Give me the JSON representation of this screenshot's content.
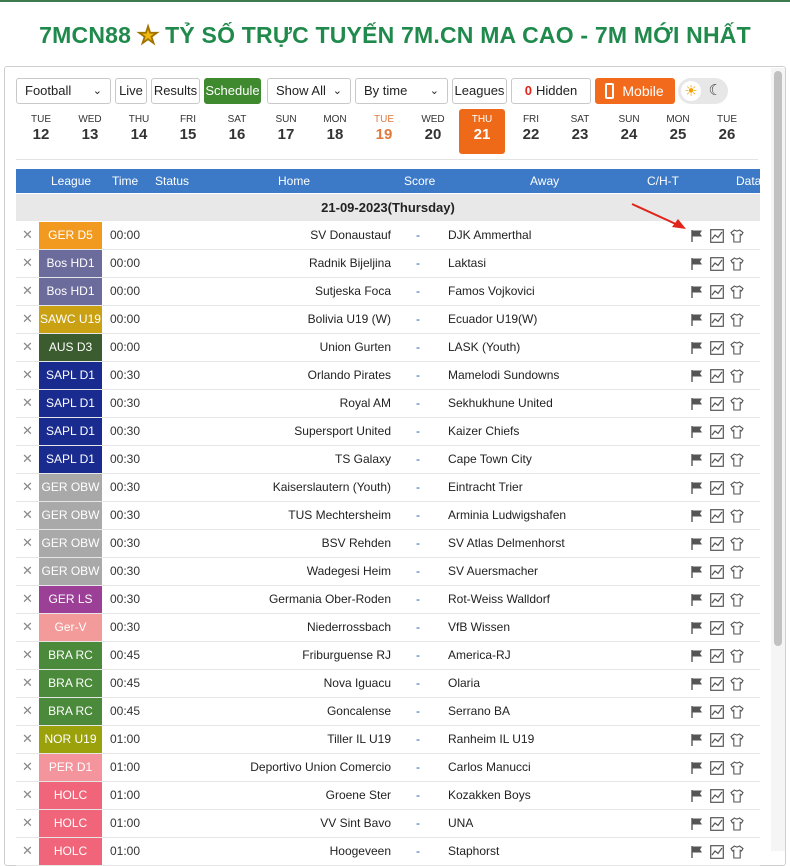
{
  "page": {
    "title_brand": "7MCN88",
    "title_star": "★",
    "title_text": "TỶ SỐ TRỰC TUYẾN 7M.CN MA CAO - 7M MỚI NHẤT"
  },
  "toolbar": {
    "sport_select": "Football",
    "live": "Live",
    "results": "Results",
    "schedule": "Schedule",
    "show_all": "Show All",
    "by_time": "By time",
    "leagues": "Leagues",
    "hidden_count": "0",
    "hidden_label": "Hidden",
    "mobile": "Mobile",
    "chevron": "⌄"
  },
  "dates": [
    {
      "dn": "TUE",
      "dd": "12"
    },
    {
      "dn": "WED",
      "dd": "13"
    },
    {
      "dn": "THU",
      "dd": "14"
    },
    {
      "dn": "FRI",
      "dd": "15"
    },
    {
      "dn": "SAT",
      "dd": "16"
    },
    {
      "dn": "SUN",
      "dd": "17"
    },
    {
      "dn": "MON",
      "dd": "18"
    },
    {
      "dn": "TUE",
      "dd": "19"
    },
    {
      "dn": "WED",
      "dd": "20"
    },
    {
      "dn": "THU",
      "dd": "21"
    },
    {
      "dn": "FRI",
      "dd": "22"
    },
    {
      "dn": "SAT",
      "dd": "23"
    },
    {
      "dn": "SUN",
      "dd": "24"
    },
    {
      "dn": "MON",
      "dd": "25"
    },
    {
      "dn": "TUE",
      "dd": "26"
    }
  ],
  "table_header": {
    "league": "League",
    "time": "Time",
    "status": "Status",
    "home": "Home",
    "score": "Score",
    "away": "Away",
    "cht": "C/H-T",
    "data": "Data"
  },
  "date_band": "21-09-2023(Thursday)",
  "colors": {
    "accent_green": "#3f8a2f",
    "header_blue": "#3c79c7",
    "today_orange": "#ee6a19",
    "title_green": "#1f8a4c"
  },
  "matches": [
    {
      "league": "GER D5",
      "color": "#f29a1f",
      "time": "00:00",
      "home": "SV Donaustauf",
      "score": "-",
      "away": "DJK Ammerthal"
    },
    {
      "league": "Bos HD1",
      "color": "#6c6c9c",
      "time": "00:00",
      "home": "Radnik Bijeljina",
      "score": "-",
      "away": "Laktasi"
    },
    {
      "league": "Bos HD1",
      "color": "#6c6c9c",
      "time": "00:00",
      "home": "Sutjeska Foca",
      "score": "-",
      "away": "Famos Vojkovici"
    },
    {
      "league": "SAWC U19",
      "color": "#c9a113",
      "time": "00:00",
      "home": "Bolivia U19 (W)",
      "score": "-",
      "away": "Ecuador U19(W)"
    },
    {
      "league": "AUS D3",
      "color": "#3b5c2e",
      "time": "00:00",
      "home": "Union Gurten",
      "score": "-",
      "away": "LASK (Youth)"
    },
    {
      "league": "SAPL D1",
      "color": "#1a2b8f",
      "time": "00:30",
      "home": "Orlando Pirates",
      "score": "-",
      "away": "Mamelodi Sundowns"
    },
    {
      "league": "SAPL D1",
      "color": "#1a2b8f",
      "time": "00:30",
      "home": "Royal AM",
      "score": "-",
      "away": "Sekhukhune United"
    },
    {
      "league": "SAPL D1",
      "color": "#1a2b8f",
      "time": "00:30",
      "home": "Supersport United",
      "score": "-",
      "away": "Kaizer Chiefs"
    },
    {
      "league": "SAPL D1",
      "color": "#1a2b8f",
      "time": "00:30",
      "home": "TS Galaxy",
      "score": "-",
      "away": "Cape Town City"
    },
    {
      "league": "GER OBW",
      "color": "#a9a9a9",
      "time": "00:30",
      "home": "Kaiserslautern (Youth)",
      "score": "-",
      "away": "Eintracht Trier"
    },
    {
      "league": "GER OBW",
      "color": "#a9a9a9",
      "time": "00:30",
      "home": "TUS Mechtersheim",
      "score": "-",
      "away": "Arminia Ludwigshafen"
    },
    {
      "league": "GER OBW",
      "color": "#a9a9a9",
      "time": "00:30",
      "home": "BSV Rehden",
      "score": "-",
      "away": "SV Atlas Delmenhorst"
    },
    {
      "league": "GER OBW",
      "color": "#a9a9a9",
      "time": "00:30",
      "home": "Wadegesi Heim",
      "score": "-",
      "away": "SV Auersmacher"
    },
    {
      "league": "GER LS",
      "color": "#9b3f97",
      "time": "00:30",
      "home": "Germania Ober-Roden",
      "score": "-",
      "away": "Rot-Weiss Walldorf"
    },
    {
      "league": "Ger-V",
      "color": "#f39a9a",
      "time": "00:30",
      "home": "Niederrossbach",
      "score": "-",
      "away": "VfB Wissen"
    },
    {
      "league": "BRA RC",
      "color": "#4a8a3a",
      "time": "00:45",
      "home": "Friburguense RJ",
      "score": "-",
      "away": "America-RJ"
    },
    {
      "league": "BRA RC",
      "color": "#4a8a3a",
      "time": "00:45",
      "home": "Nova Iguacu",
      "score": "-",
      "away": "Olaria"
    },
    {
      "league": "BRA RC",
      "color": "#4a8a3a",
      "time": "00:45",
      "home": "Goncalense",
      "score": "-",
      "away": "Serrano BA"
    },
    {
      "league": "NOR U19",
      "color": "#9aa10b",
      "time": "01:00",
      "home": "Tiller IL U19",
      "score": "-",
      "away": "Ranheim IL U19"
    },
    {
      "league": "PER D1",
      "color": "#f4949c",
      "time": "01:00",
      "home": "Deportivo Union Comercio",
      "score": "-",
      "away": "Carlos Manucci"
    },
    {
      "league": "HOLC",
      "color": "#f0657a",
      "time": "01:00",
      "home": "Groene Ster",
      "score": "-",
      "away": "Kozakken Boys"
    },
    {
      "league": "HOLC",
      "color": "#f0657a",
      "time": "01:00",
      "home": "VV Sint Bavo",
      "score": "-",
      "away": "UNA"
    },
    {
      "league": "HOLC",
      "color": "#f0657a",
      "time": "01:00",
      "home": "Hoogeveen",
      "score": "-",
      "away": "Staphorst"
    }
  ],
  "icons": {
    "hide": "close-icon",
    "flag": "flag-icon",
    "chart": "chart-icon",
    "shirt": "shirt-icon",
    "sun": "sun-icon",
    "moon": "moon-icon",
    "phone": "phone-icon"
  }
}
